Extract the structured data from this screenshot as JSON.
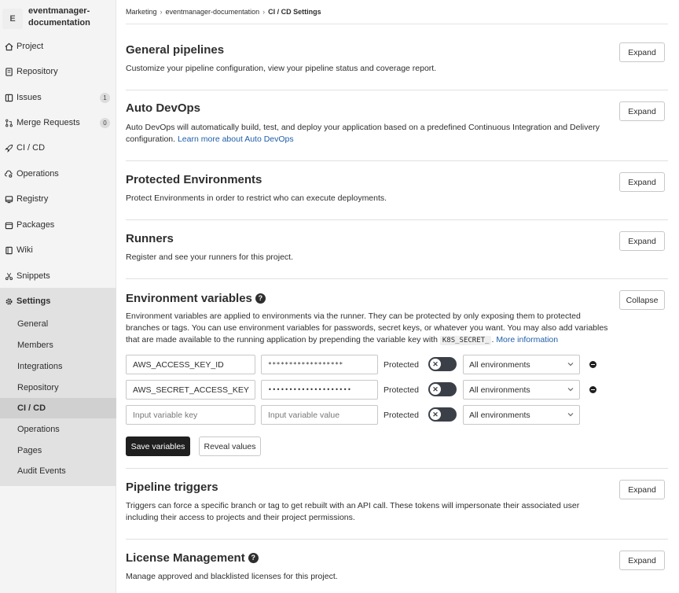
{
  "project": {
    "avatar_letter": "E",
    "name": "eventmanager-documentation"
  },
  "sidebar": {
    "items": [
      {
        "label": "Project"
      },
      {
        "label": "Repository"
      },
      {
        "label": "Issues",
        "badge": "1"
      },
      {
        "label": "Merge Requests",
        "badge": "0"
      },
      {
        "label": "CI / CD"
      },
      {
        "label": "Operations"
      },
      {
        "label": "Registry"
      },
      {
        "label": "Packages"
      },
      {
        "label": "Wiki"
      },
      {
        "label": "Snippets"
      },
      {
        "label": "Settings"
      }
    ],
    "settings_items": [
      {
        "label": "General"
      },
      {
        "label": "Members"
      },
      {
        "label": "Integrations"
      },
      {
        "label": "Repository"
      },
      {
        "label": "CI / CD"
      },
      {
        "label": "Operations"
      },
      {
        "label": "Pages"
      },
      {
        "label": "Audit Events"
      }
    ]
  },
  "breadcrumb": {
    "group": "Marketing",
    "project": "eventmanager-documentation",
    "current": "CI / CD Settings"
  },
  "sections": {
    "general": {
      "title": "General pipelines",
      "desc": "Customize your pipeline configuration, view your pipeline status and coverage report.",
      "button": "Expand"
    },
    "autodevops": {
      "title": "Auto DevOps",
      "desc": "Auto DevOps will automatically build, test, and deploy your application based on a predefined Continuous Integration and Delivery configuration.",
      "link": "Learn more about Auto DevOps",
      "button": "Expand"
    },
    "protected": {
      "title": "Protected Environments",
      "desc": "Protect Environments in order to restrict who can execute deployments.",
      "button": "Expand"
    },
    "runners": {
      "title": "Runners",
      "desc": "Register and see your runners for this project.",
      "button": "Expand"
    },
    "envvars": {
      "title": "Environment variables",
      "help": "?",
      "desc": "Environment variables are applied to environments via the runner. They can be protected by only exposing them to protected branches or tags. You can use environment variables for passwords, secret keys, or whatever you want. You may also add variables that are made available to the running application by prepending the variable key with",
      "code": "K8S_SECRET_",
      "desc_end": ".",
      "link": "More information",
      "button": "Collapse",
      "rows": [
        {
          "key": "AWS_ACCESS_KEY_ID",
          "value": "******************",
          "protected": "Protected",
          "toggle": "✕",
          "scope": "All environments"
        },
        {
          "key": "AWS_SECRET_ACCESS_KEY",
          "value": "••••••••••••••••••••",
          "protected": "Protected",
          "toggle": "✕",
          "scope": "All environments"
        }
      ],
      "new_row": {
        "key_placeholder": "Input variable key",
        "value_placeholder": "Input variable value",
        "protected": "Protected",
        "toggle": "✕",
        "scope": "All environments"
      },
      "save_button": "Save variables",
      "reveal_button": "Reveal values"
    },
    "triggers": {
      "title": "Pipeline triggers",
      "desc": "Triggers can force a specific branch or tag to get rebuilt with an API call. These tokens will impersonate their associated user including their access to projects and their project permissions.",
      "button": "Expand"
    },
    "license": {
      "title": "License Management",
      "help": "?",
      "desc": "Manage approved and blacklisted licenses for this project.",
      "button": "Expand"
    }
  },
  "colors": {
    "accent": "#1f5ea8",
    "sidebar_bg": "#f4f4f4",
    "settings_bg": "#e1e1e1",
    "toggle": "#3b4048",
    "save_button": "#1f1f1f"
  }
}
